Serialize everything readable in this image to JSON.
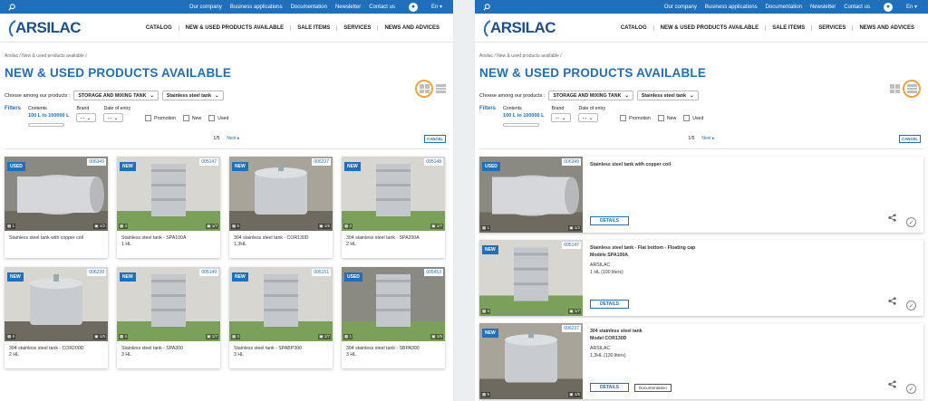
{
  "topbar": {
    "links": [
      "Our company",
      "Business applications",
      "Documentation",
      "Newsletter",
      "Contact us"
    ],
    "lang": "En"
  },
  "logo": "ARSILAC",
  "nav": [
    "CATALOG",
    "NEW & USED PRODUCTS AVAILABLE",
    "SALE ITEMS",
    "SERVICES",
    "NEWS AND ADVICES"
  ],
  "breadcrumb": "Arsilac  /  New & used products available  /",
  "page_title": "NEW & USED PRODUCTS AVAILABLE",
  "choose": {
    "label": "Choose among our products :",
    "cat": "STORAGE AND MIXING TANK",
    "sub": "Stainless steel tank"
  },
  "filters": {
    "label": "Filters",
    "contents_label": "Contents",
    "contents_value": "100 L to 100000 L",
    "brand_label": "Brand",
    "brand_value": "...",
    "date_label": "Date of entry",
    "date_value": "...",
    "promotion": "Promotion",
    "new": "New",
    "used": "Used"
  },
  "pager": {
    "page": "1/5",
    "next": "Next ▸",
    "cancel": "CANCEL"
  },
  "grid": [
    {
      "tag": "USED",
      "ref": "006349",
      "count": "1",
      "photos": "1/2",
      "title": "Stainless steel tank with copper coil",
      "sub": ""
    },
    {
      "tag": "NEW",
      "ref": "005147",
      "count": "4",
      "photos": "1/7",
      "title": "Stainless steel tank - SPA100A",
      "sub": "1 HL"
    },
    {
      "tag": "NEW",
      "ref": "006237",
      "count": "5",
      "photos": "1/5",
      "title": "304 stainless steel tank - COR130D",
      "sub": "1,3HL"
    },
    {
      "tag": "NEW",
      "ref": "005148",
      "count": "2",
      "photos": "1/7",
      "title": "304 stainless steel tank - SPA200A",
      "sub": "2 HL"
    },
    {
      "tag": "NEW",
      "ref": "006238",
      "count": "6",
      "photos": "1/6",
      "title": "304 stainless steel tank - COR200D",
      "sub": "2 HL"
    },
    {
      "tag": "NEW",
      "ref": "005149",
      "count": "4",
      "photos": "1/7",
      "title": "Stainless steel tank - SPA300",
      "sub": "3 HL"
    },
    {
      "tag": "NEW",
      "ref": "005151",
      "count": "3",
      "photos": "1/7",
      "title": "Stainless steel tank - SPABP300",
      "sub": "3 HL"
    },
    {
      "tag": "USED",
      "ref": "005453",
      "count": "1",
      "photos": "1/5",
      "title": "304 stainless steel tank - SBPA300",
      "sub": "3 HL"
    }
  ],
  "list": [
    {
      "tag": "USED",
      "ref": "006349",
      "count": "1",
      "photos": "1/2",
      "lines": [
        "Stainless steel tank with copper coil"
      ],
      "brand": "",
      "cap": "",
      "details": "DETAILS",
      "doc": ""
    },
    {
      "tag": "NEW",
      "ref": "005147",
      "count": "4",
      "photos": "1/7",
      "lines": [
        "Stainless steel tank - Flat bottom - Floating cap",
        "Modèle SPA100A"
      ],
      "brand": "ARSILAC",
      "cap": "1 HL (100 liters)",
      "details": "DETAILS",
      "doc": ""
    },
    {
      "tag": "NEW",
      "ref": "006237",
      "count": "5",
      "photos": "1/5",
      "lines": [
        "304 stainless steel tank",
        "Model COR130D"
      ],
      "brand": "ARSILAC",
      "cap": "1,3HL (130 liters)",
      "details": "DETAILS",
      "doc": "Documentation"
    }
  ]
}
